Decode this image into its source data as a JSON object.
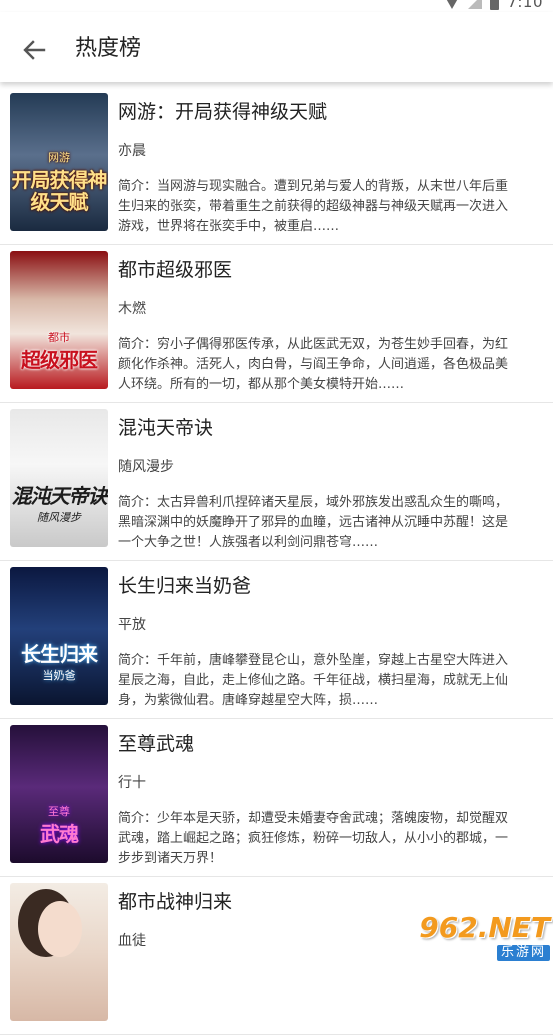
{
  "status_bar": {
    "time": "7:10"
  },
  "app_bar": {
    "title": "热度榜"
  },
  "books": [
    {
      "title": "网游：开局获得神级天赋",
      "author": "亦晨",
      "desc": "简介：当网游与现实融合。遭到兄弟与爱人的背叛，从末世八年后重生归来的张奕，带着重生之前获得的超级神器与神级天赋再一次进入游戏，世界将在张奕手中，被重启……",
      "cover_text": "开局获得神级天赋",
      "cover_sub": "网游"
    },
    {
      "title": "都市超级邪医",
      "author": "木燃",
      "desc": "简介：穷小子偶得邪医传承，从此医武无双，为苍生妙手回春，为红颜化作杀神。活死人，肉白骨，与阎王争命，人间逍遥，各色极品美人环绕。所有的一切，都从那个美女模特开始……",
      "cover_text": "超级邪医",
      "cover_sub": "都市"
    },
    {
      "title": "混沌天帝诀",
      "author": "随风漫步",
      "desc": "简介：太古异兽利爪捏碎诸天星辰，域外邪族发出惑乱众生的嘶鸣，黑暗深渊中的妖魔睁开了邪异的血瞳，远古诸神从沉睡中苏醒！这是一个大争之世！人族强者以利剑问鼎苍穹……",
      "cover_text": "混沌天帝诀",
      "cover_sub": "随风漫步"
    },
    {
      "title": "长生归来当奶爸",
      "author": "平放",
      "desc": "简介：千年前，唐峰攀登昆仑山，意外坠崖，穿越上古星空大阵进入星辰之海，自此，走上修仙之路。千年征战，横扫星海，成就无上仙身，为紫微仙君。唐峰穿越星空大阵，损……",
      "cover_text": "长生归来",
      "cover_sub": "当奶爸"
    },
    {
      "title": "至尊武魂",
      "author": "行十",
      "desc": "简介：少年本是天骄，却遭受未婚妻夺舍武魂；落魄废物，却觉醒双武魂，踏上崛起之路；疯狂修炼，粉碎一切敌人，从小小的郡城，一步步到诸天万界！",
      "cover_text": "武魂",
      "cover_sub": "至尊"
    },
    {
      "title": "都市战神归来",
      "author": "血徒",
      "desc": "",
      "cover_text": "",
      "cover_sub": ""
    }
  ],
  "watermark": {
    "top": "962.NET",
    "bottom": "乐游网"
  }
}
